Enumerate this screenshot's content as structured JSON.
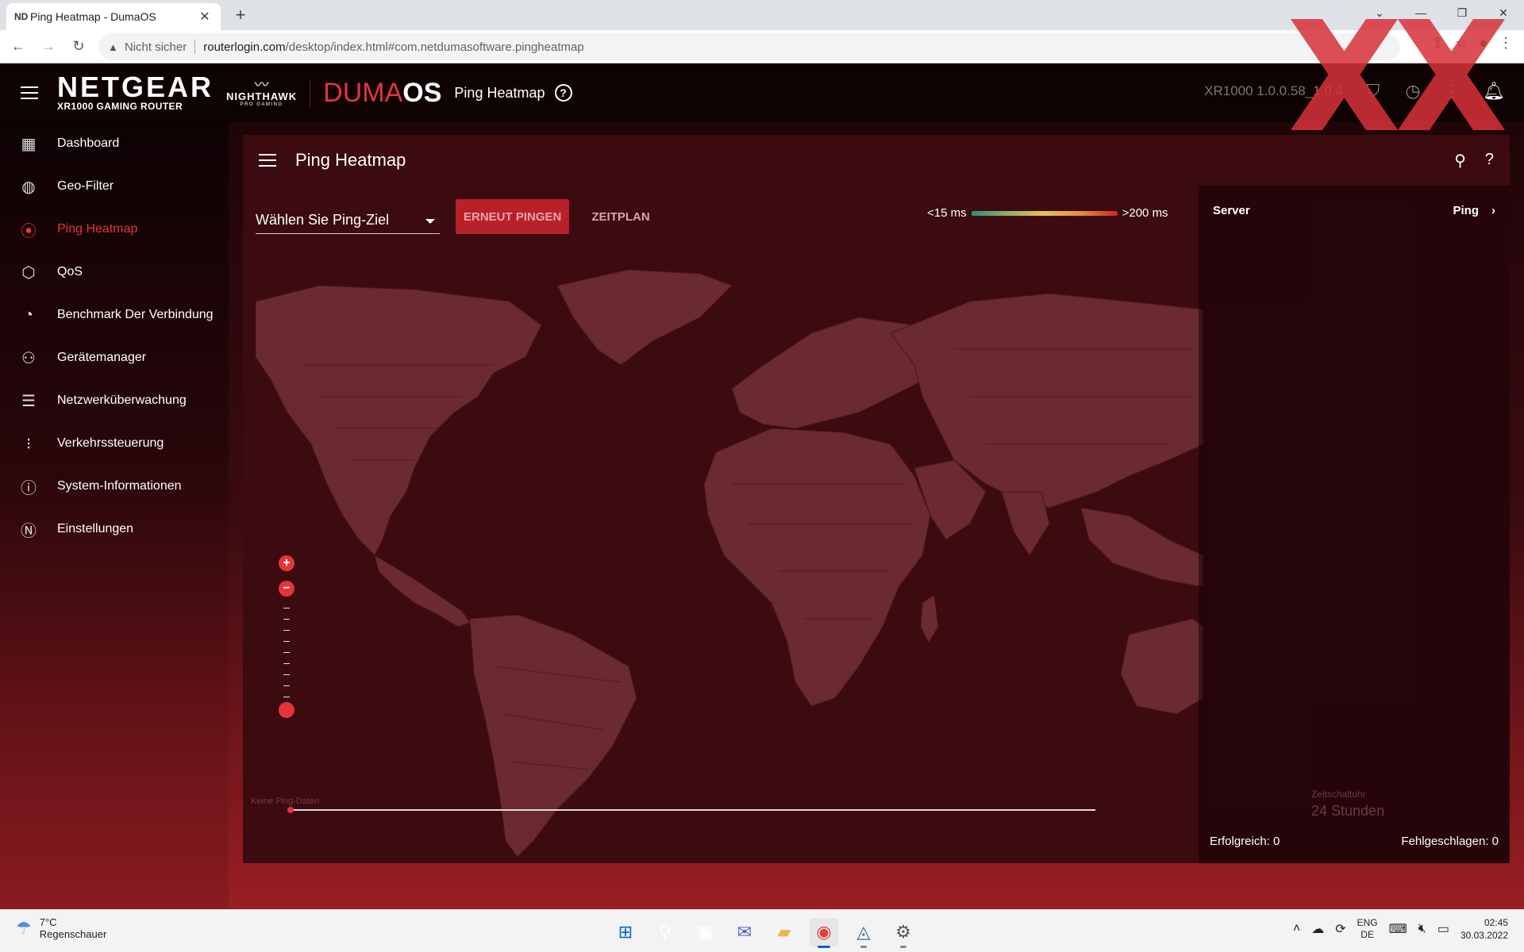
{
  "browser": {
    "tab_favicon": "ND",
    "tab_title": "Ping Heatmap - DumaOS",
    "new_tab": "+",
    "not_secure": "Nicht sicher",
    "url_host": "routerlogin.com",
    "url_path": "/desktop/index.html#com.netdumasoftware.pingheatmap"
  },
  "header": {
    "brand": "NETGEAR",
    "model": "XR1000 GAMING ROUTER",
    "nighthawk": "NIGHTHAWK",
    "nighthawk_sub": "PRO GAMING",
    "duma_light": "DUMA",
    "duma_bold": "OS",
    "page_title": "Ping Heatmap",
    "help": "?",
    "version": "XR1000 1.0.0.58_1.0.4"
  },
  "sidebar": {
    "items": [
      {
        "label": "Dashboard",
        "icon": "dashboard-icon"
      },
      {
        "label": "Geo-Filter",
        "icon": "geo-filter-icon"
      },
      {
        "label": "Ping Heatmap",
        "icon": "ping-heatmap-icon"
      },
      {
        "label": "QoS",
        "icon": "qos-icon"
      },
      {
        "label": "Benchmark Der Verbindung",
        "icon": "speedometer-icon"
      },
      {
        "label": "Gerätemanager",
        "icon": "device-tree-icon"
      },
      {
        "label": "Netzwerküberwachung",
        "icon": "network-monitor-icon"
      },
      {
        "label": "Verkehrssteuerung",
        "icon": "traffic-light-icon"
      },
      {
        "label": "System-Informationen",
        "icon": "info-icon"
      },
      {
        "label": "Einstellungen",
        "icon": "settings-icon"
      }
    ],
    "active_index": 2
  },
  "panel": {
    "title": "Ping Heatmap",
    "select_placeholder": "Wählen Sie Ping-Ziel",
    "repin_button": "ERNEUT PINGEN",
    "schedule_button": "ZEITPLAN",
    "legend_min": "<15 ms",
    "legend_max": ">200 ms",
    "zoom_in": "+",
    "zoom_out": "−",
    "timeline_label": "Keine Ping-Daten"
  },
  "server_list": {
    "col_server": "Server",
    "col_ping": "Ping",
    "schedule_label": "Zeitschaltuhr",
    "schedule_value": "24 Stunden",
    "success": "Erfolgreich: 0",
    "failed": "Fehlgeschlagen: 0"
  },
  "taskbar": {
    "temp": "7°C",
    "weather": "Regenschauer",
    "lang_1": "ENG",
    "lang_2": "DE",
    "time": "02:45",
    "date": "30.03.2022"
  },
  "colors": {
    "accent": "#e3353d",
    "panel_bg": "#3b0b10",
    "land": "#6a2a30"
  }
}
